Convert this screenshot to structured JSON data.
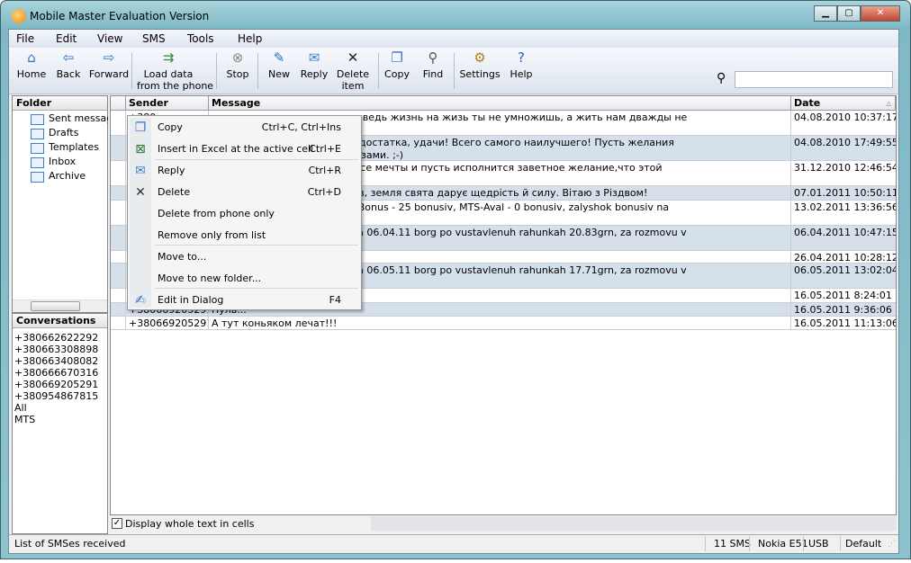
{
  "window": {
    "title": "Mobile Master Evaluation Version",
    "minimize": "▁",
    "maximize": "▢",
    "close": "✕"
  },
  "menu": [
    "File",
    "Edit",
    "View",
    "SMS",
    "Tools",
    "Help"
  ],
  "toolbar": [
    {
      "label": "Home",
      "icon": "home-icon",
      "glyph": "⌂"
    },
    {
      "label": "Back",
      "icon": "back-arrow-icon",
      "glyph": "⇦"
    },
    {
      "label": "Forward",
      "icon": "forward-arrow-icon",
      "glyph": "⇨"
    },
    {
      "label": "Load data\nfrom the phone",
      "icon": "load-data-icon",
      "glyph": "⇉"
    },
    {
      "label": "Stop",
      "icon": "stop-icon",
      "glyph": "⊗"
    },
    {
      "label": "New",
      "icon": "new-icon",
      "glyph": "✎"
    },
    {
      "label": "Reply",
      "icon": "reply-icon",
      "glyph": "✉"
    },
    {
      "label": "Delete\nitem",
      "icon": "delete-icon",
      "glyph": "✕"
    },
    {
      "label": "Copy",
      "icon": "copy-icon",
      "glyph": "❐"
    },
    {
      "label": "Find",
      "icon": "find-icon",
      "glyph": "⚲"
    },
    {
      "label": "Settings",
      "icon": "settings-icon",
      "glyph": "⚙"
    },
    {
      "label": "Help",
      "icon": "help-icon",
      "glyph": "?"
    }
  ],
  "search": {
    "value": "",
    "placeholder": ""
  },
  "folder_panel": {
    "title": "Folder",
    "items": [
      "Sent messag",
      "Drafts",
      "Templates",
      "Inbox",
      "Archive"
    ]
  },
  "conversations": {
    "title": "Conversations",
    "items": [
      "+380662622292",
      "+380663308898",
      "+380663408082",
      "+380666670316",
      "+380669205291",
      "+380954867815",
      "All",
      "MTS"
    ]
  },
  "grid": {
    "columns": [
      "Sender",
      "Message",
      "Date"
    ],
    "rows": [
      {
        "sender": "+380...",
        "message": "все, что прекрасно и светло,ведь жизнь на жизь ты не умножишь, а жить нам дважды не\nмеханики.",
        "date": "04.08.2010 10:37:17"
      },
      {
        "sender": "",
        "message": "стья, любви, благополучия, достатка, удачи! Всего самого наилучшего! Пусть желания\nует тебя приятными сюрпризами. ;-)",
        "date": "04.08.2010 17:49:55"
      },
      {
        "sender": "",
        "message": "тливым,пусть станут явью все мечты и пусть исполнится заветное желание,что этой",
        "date": "31.12.2010 12:46:54"
      },
      {
        "sender": "",
        "message": "ивуть у хаті злагода й любов, земля свята дарує щедрість й силу. Вітаю з Різдвом!",
        "date": "07.01.2011 10:50:11"
      },
      {
        "sender": "",
        "message": "isyats Vam narahovano: MTS Bonus - 25 bonusiv, MTS-Aval - 0 bonusiv, zalyshok bonusiv na",
        "date": "13.02.2011 13:36:56"
      },
      {
        "sender": "",
        "message": "31.03.11 31.88grn. Stanom na 06.04.11 borg po vustavlenuh rahunkah 20.83grn, za rozmovu v",
        "date": "06.04.2011 10:47:15"
      },
      {
        "sender": "",
        "message": "",
        "date": "26.04.2011 10:28:12"
      },
      {
        "sender": "",
        "message": "30.04.11 31.88grn. Stanom na 06.05.11 borg po vustavlenuh rahunkah 17.71grn, za rozmovu v",
        "date": "06.05.2011 13:02:04"
      },
      {
        "sender": "",
        "message": "эже",
        "date": "16.05.2011 8:24:01"
      },
      {
        "sender": "+380669205291",
        "message": "Нуль...",
        "date": "16.05.2011 9:36:06"
      },
      {
        "sender": "+380669205291",
        "message": "А тут коньяком лечат!!!",
        "date": "16.05.2011 11:13:06"
      }
    ]
  },
  "display_whole_text": {
    "label": "Display whole text in cells",
    "checked": true
  },
  "status": {
    "left": "List of SMSes received",
    "count": "11 SMS",
    "phone": "Nokia E51",
    "connection": "USB",
    "profile": "Default"
  },
  "context_menu": [
    {
      "label": "Copy",
      "shortcut": "Ctrl+C, Ctrl+Ins",
      "icon": "copy-icon",
      "glyph": "❐"
    },
    {
      "label": "Insert in Excel at the active cell",
      "shortcut": "Ctrl+E",
      "icon": "excel-icon",
      "glyph": "⊠"
    },
    {
      "label": "Reply",
      "shortcut": "Ctrl+R",
      "icon": "reply-icon",
      "glyph": "✉"
    },
    {
      "label": "Delete",
      "shortcut": "Ctrl+D",
      "icon": "delete-icon",
      "glyph": "✕"
    },
    {
      "label": "Delete from phone only",
      "shortcut": "",
      "icon": "",
      "glyph": ""
    },
    {
      "label": "Remove only from list",
      "shortcut": "",
      "icon": "",
      "glyph": ""
    },
    {
      "label": "Move to...",
      "shortcut": "",
      "icon": "",
      "glyph": ""
    },
    {
      "label": "Move to new folder...",
      "shortcut": "",
      "icon": "",
      "glyph": ""
    },
    {
      "label": "Edit in Dialog",
      "shortcut": "F4",
      "icon": "edit-dialog-icon",
      "glyph": "✍"
    }
  ]
}
